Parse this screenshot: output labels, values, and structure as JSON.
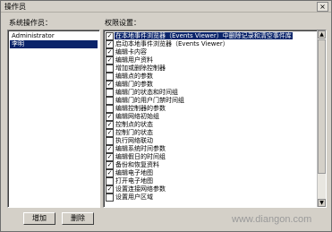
{
  "window": {
    "title": "操作员",
    "close_glyph": "×"
  },
  "operators": {
    "label": "系统操作员：",
    "items": [
      {
        "name": "Administrator",
        "selected": false
      },
      {
        "name": "李明",
        "selected": true
      }
    ]
  },
  "permissions": {
    "label": "权限设置：",
    "items": [
      {
        "text": "在本地事件浏览器（Events Viewer）中删除记录和清空事件库",
        "checked": true,
        "selected": true
      },
      {
        "text": "启动本地事件浏览器（Events Viewer）",
        "checked": true,
        "selected": false
      },
      {
        "text": "编辑卡内容",
        "checked": true,
        "selected": false
      },
      {
        "text": "编辑用户资料",
        "checked": true,
        "selected": false
      },
      {
        "text": "增加或删除控制器",
        "checked": false,
        "selected": false
      },
      {
        "text": "编辑点的参数",
        "checked": false,
        "selected": false
      },
      {
        "text": "编辑门的参数",
        "checked": true,
        "selected": false
      },
      {
        "text": "编辑门的状态和时间组",
        "checked": false,
        "selected": false
      },
      {
        "text": "编辑门的用户门禁时间组",
        "checked": false,
        "selected": false
      },
      {
        "text": "编辑控制器的参数",
        "checked": false,
        "selected": false
      },
      {
        "text": "编辑网络初始组",
        "checked": true,
        "selected": false
      },
      {
        "text": "控制点的状态",
        "checked": true,
        "selected": false
      },
      {
        "text": "控制门的状态",
        "checked": true,
        "selected": false
      },
      {
        "text": "执行网络联动",
        "checked": false,
        "selected": false
      },
      {
        "text": "编辑系统时间参数",
        "checked": true,
        "selected": false
      },
      {
        "text": "编辑假日的时间组",
        "checked": true,
        "selected": false
      },
      {
        "text": "备份和恢复资料",
        "checked": true,
        "selected": false
      },
      {
        "text": "编辑电子地图",
        "checked": true,
        "selected": false
      },
      {
        "text": "打开电子地图",
        "checked": false,
        "selected": false
      },
      {
        "text": "设置连接网络参数",
        "checked": true,
        "selected": false
      },
      {
        "text": "设置用户区域",
        "checked": false,
        "selected": false
      }
    ]
  },
  "buttons": {
    "add": "增加",
    "delete": "删除"
  },
  "watermark": "www.diangon.com"
}
